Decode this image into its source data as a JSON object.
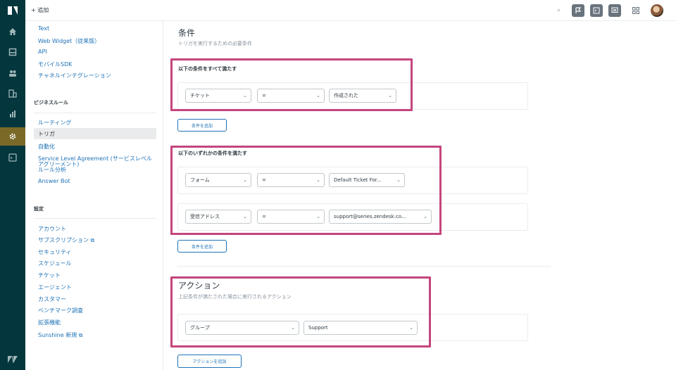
{
  "topbar": {
    "add_label": "+ 追加"
  },
  "sidebar": {
    "links_top": [
      "Text",
      "Web Widget（従来版）",
      "API",
      "モバイルSDK",
      "チャネルインテグレーション"
    ],
    "section_business": "ビジネスルール",
    "business_items": [
      "ルーティング",
      "トリガ",
      "自動化",
      "Service Level Agreement (サービスレベル",
      "アグリーメント)",
      "ルール分析",
      "Answer Bot"
    ],
    "section_settings": "設定",
    "settings_items": [
      "アカウント",
      "サブスクリプション ⧉",
      "セキュリティ",
      "スケジュール",
      "チケット",
      "エージェント",
      "カスタマー",
      "ベンチマーク調査",
      "拡張機能",
      "Sunshine 新規 ⧉"
    ]
  },
  "main": {
    "title": "条件",
    "subtitle": "トリガを実行するための必要条件",
    "all": {
      "heading": "以下の条件をすべて満たす",
      "row": [
        "チケット",
        "=",
        "作成された"
      ],
      "add_button": "条件を追加"
    },
    "any": {
      "heading": "以下のいずれかの条件を満たす",
      "row1": [
        "フォーム",
        "=",
        "Default Ticket For..."
      ],
      "row2": [
        "受信アドレス",
        "=",
        "support@series.zendesk.co..."
      ],
      "add_button": "条件を追加"
    },
    "actions": {
      "title": "アクション",
      "subtitle": "上記条件が満たされた場合に実行されるアクション",
      "row": [
        "グループ",
        "Support"
      ],
      "add_button": "アクションを追加"
    }
  },
  "colors": {
    "rail": "#03363d",
    "accent": "#1f73b7",
    "highlight": "#c4457d",
    "active_rail": "#7a6a28"
  }
}
